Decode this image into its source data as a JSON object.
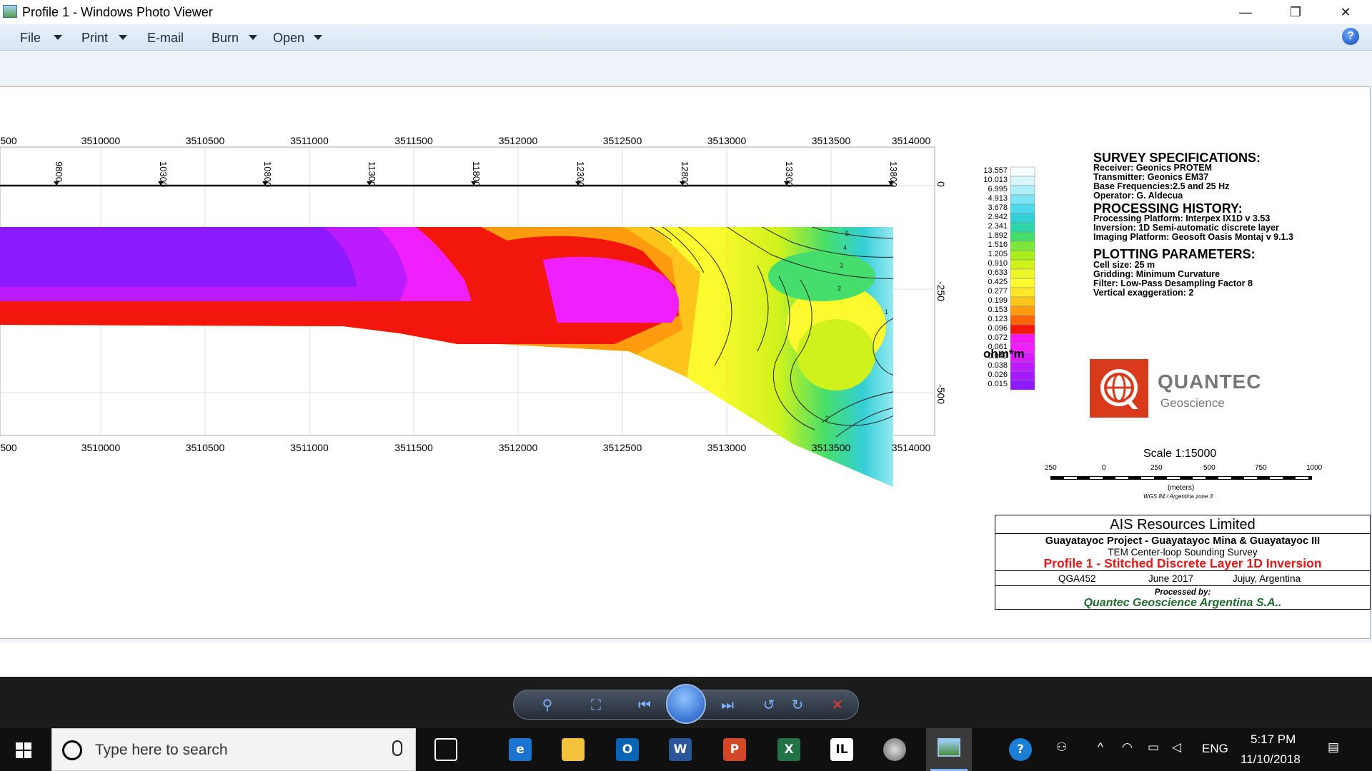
{
  "window": {
    "title": "Profile 1 - Windows Photo Viewer",
    "minimize_glyph": "—",
    "restore_glyph": "❐",
    "close_glyph": "✕"
  },
  "menu": {
    "file": "File",
    "print": "Print",
    "email": "E-mail",
    "burn": "Burn",
    "open": "Open",
    "help": "?"
  },
  "profile": {
    "x_ticks": [
      "500",
      "3510000",
      "3510500",
      "3511000",
      "3511500",
      "3512000",
      "3512500",
      "3513000",
      "3513500",
      "3514000"
    ],
    "stations": [
      "9800",
      "10300",
      "10800",
      "11300",
      "11800",
      "12300",
      "12800",
      "13300",
      "13800"
    ],
    "depth_ticks": [
      "0",
      "-250",
      "-500"
    ],
    "contour_labels": [
      "5",
      "4",
      "3",
      "2",
      "1",
      "2"
    ]
  },
  "colorbar": {
    "values": [
      "13.557",
      "10.013",
      "6.995",
      "4.913",
      "3.678",
      "2.942",
      "2.341",
      "1.892",
      "1.516",
      "1.205",
      "0.910",
      "0.633",
      "0.425",
      "0.277",
      "0.199",
      "0.153",
      "0.123",
      "0.096",
      "0.072",
      "0.061",
      "0.049",
      "0.038",
      "0.026",
      "0.015"
    ],
    "colors": [
      "#f6fdfd",
      "#d7f7fb",
      "#aeeff7",
      "#7de4f3",
      "#4fd8ed",
      "#33cfd6",
      "#2fd7a8",
      "#45de6c",
      "#7be83a",
      "#a8ee1e",
      "#cff21c",
      "#ecf82a",
      "#fcfa2e",
      "#fde728",
      "#fdc51c",
      "#fe9b0e",
      "#fb6405",
      "#f2160c",
      "#f419f0",
      "#f01fff",
      "#d71cff",
      "#bc1aff",
      "#a51aff",
      "#8d19ff"
    ],
    "unit": "ohm*m"
  },
  "specs": {
    "survey_title": "SURVEY SPECIFICATIONS:",
    "survey_lines": [
      "Receiver: Geonics PROTEM",
      "Transmitter: Geonics EM37",
      "Base Frequencies:2.5 and 25 Hz",
      "Operator: G. Aldecua"
    ],
    "processing_title": "PROCESSING HISTORY:",
    "processing_lines": [
      "Processing Platform: Interpex IX1D v 3.53",
      "Inversion: 1D Semi-automatic discrete layer",
      "Imaging Platform: Geosoft Oasis Montaj v 9.1.3"
    ],
    "plotting_title": "PLOTTING PARAMETERS:",
    "plotting_lines": [
      "Cell size: 25 m",
      "Gridding: Minimum Curvature",
      "Filter: Low-Pass Desampling Factor 8",
      "Vertical exaggeration: 2"
    ]
  },
  "logo": {
    "name": "QUANTEC",
    "sub": "Geoscience"
  },
  "scale": {
    "title": "Scale 1:15000",
    "ticks": [
      "250",
      "0",
      "250",
      "500",
      "750",
      "1000"
    ],
    "unit": "(meters)",
    "datum": "WGS 84 / Argentina zone 3"
  },
  "titleblock": {
    "company": "AIS Resources Limited",
    "project": "Guayatayoc  Project - Guayatayoc Mina & Guayatayoc III",
    "survey": "TEM Center-loop Sounding Survey",
    "profile": "Profile 1 - Stitched Discrete Layer 1D Inversion",
    "code": "QGA452",
    "date": "June 2017",
    "location": "Jujuy, Argentina",
    "processed_by": "Processed by:",
    "processor": "Quantec Geoscience Argentina S.A.."
  },
  "taskbar": {
    "search_placeholder": "Type here to search",
    "time": "5:17 PM",
    "date": "11/10/2018",
    "lang": "ENG"
  },
  "colors": {
    "accent_red": "#e81717",
    "logo_red": "#d93a1c",
    "processor_green": "#1b6a2a"
  }
}
